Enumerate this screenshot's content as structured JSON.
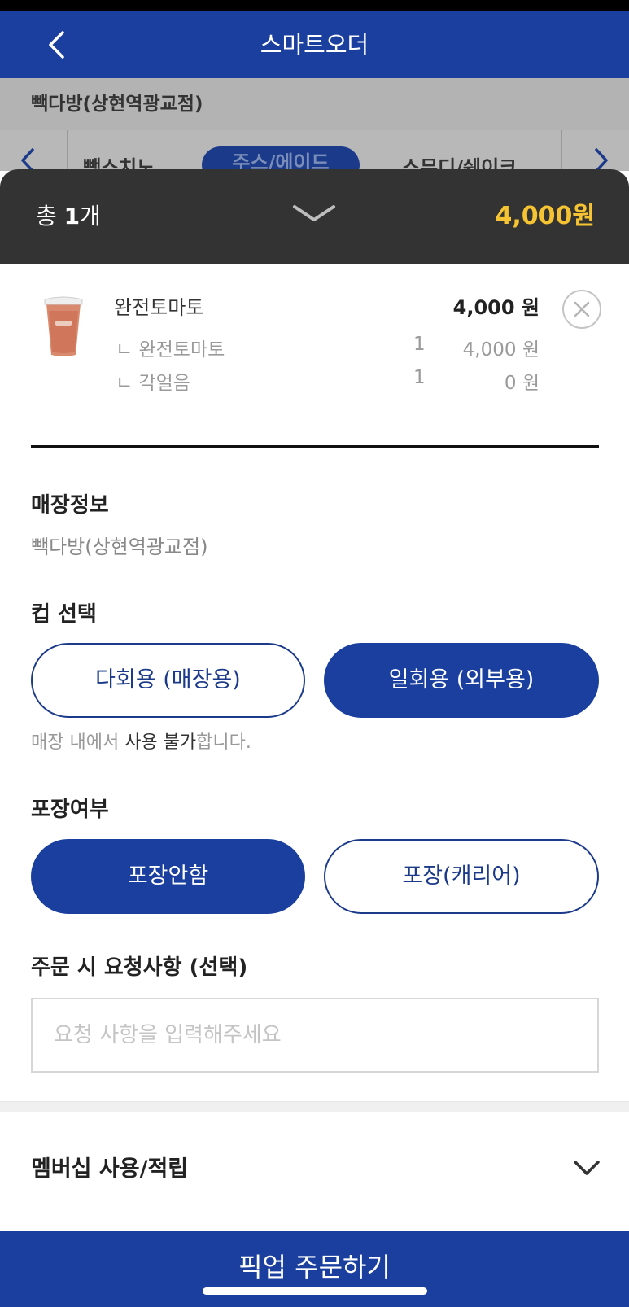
{
  "header": {
    "title": "스마트오더"
  },
  "store_bar": {
    "store_name": "빽다방(상현역광교점)"
  },
  "categories": [
    {
      "label": "빽스치노"
    },
    {
      "label": "주스/에이드"
    },
    {
      "label": "스무디/쉐이크"
    }
  ],
  "cart_summary": {
    "total_prefix": "총",
    "total_count": "1",
    "total_suffix": "개",
    "total_price": "4,000원"
  },
  "cart_item": {
    "name": "완전토마토",
    "price": "4,000 원",
    "options": [
      {
        "name": "ㄴ 완전토마토",
        "qty": "1",
        "price": "4,000 원"
      },
      {
        "name": "ㄴ 각얼음",
        "qty": "1",
        "price": "0 원"
      }
    ]
  },
  "store_info": {
    "title": "매장정보",
    "value": "빽다방(상현역광교점)"
  },
  "cup": {
    "title": "컵 선택",
    "options": [
      "다회용 (매장용)",
      "일회용 (외부용)"
    ],
    "selected": "일회용 (외부용)",
    "note_part1": "매장 내에서 ",
    "note_part2": "사용 불가",
    "note_part3": "합니다."
  },
  "packaging": {
    "title": "포장여부",
    "options": [
      "포장안함",
      "포장(캐리어)"
    ],
    "selected": "포장안함"
  },
  "request": {
    "title": "주문 시 요청사항 (선택)",
    "placeholder": "요청 사항을 입력해주세요",
    "value": ""
  },
  "membership": {
    "label": "멤버십 사용/적립"
  },
  "order_button": {
    "label": "픽업 주문하기"
  },
  "colors": {
    "primary": "#1a3f9e",
    "sheet_header": "#333333",
    "price_accent": "#f6c432"
  }
}
